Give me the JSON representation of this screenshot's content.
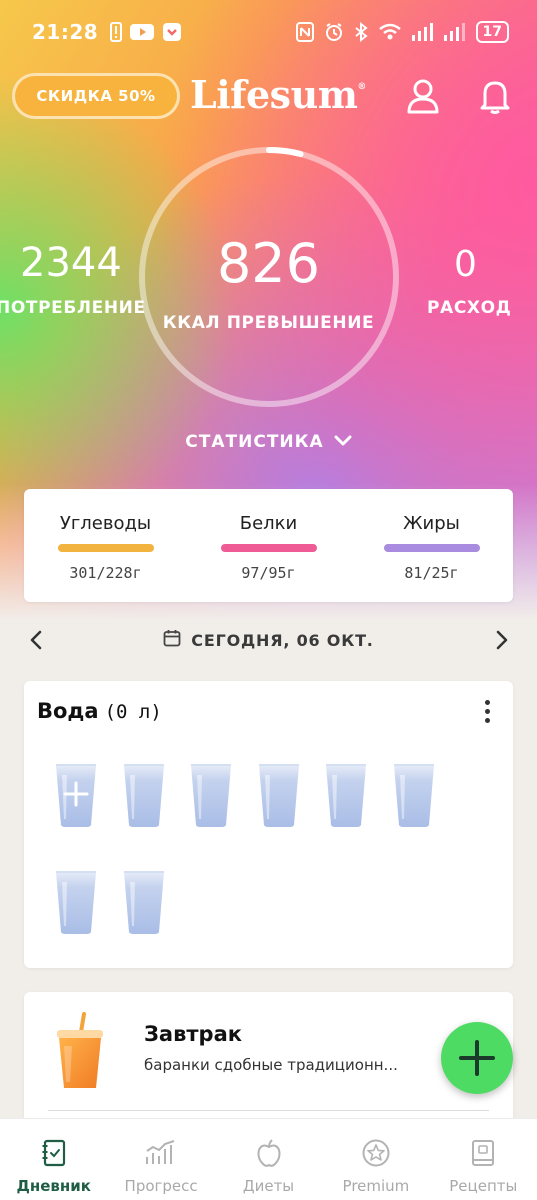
{
  "status_bar": {
    "time": "21:28",
    "battery": "17"
  },
  "header": {
    "discount_label": "СКИДКА 50%",
    "logo": "Lifesum",
    "logo_mark": "®"
  },
  "summary": {
    "intake_value": "2344",
    "intake_label": "ПОТРЕБЛЕНИЕ",
    "center_value": "826",
    "center_label": "ККАЛ ПРЕВЫШЕНИЕ",
    "burned_value": "0",
    "burned_label": "РАСХОД",
    "ring_progress": 0.04,
    "stats_label": "СТАТИСТИКА"
  },
  "macros": [
    {
      "name": "Углеводы",
      "value": "301/228г",
      "color": "#f2b33f"
    },
    {
      "name": "Белки",
      "value": "97/95г",
      "color": "#ef5b95"
    },
    {
      "name": "Жиры",
      "value": "81/25г",
      "color": "#a98be0"
    }
  ],
  "date": {
    "label": "СЕГОДНЯ, 06 ОКТ."
  },
  "water": {
    "title": "Вода",
    "amount": "(0 л)",
    "glass_count": 8
  },
  "meal": {
    "title": "Завтрак",
    "subtitle": "баранки сдобные традиционн..."
  },
  "nav": [
    {
      "label": "Дневник",
      "icon": "diary-icon",
      "active": true
    },
    {
      "label": "Прогресс",
      "icon": "progress-chart-icon",
      "active": false
    },
    {
      "label": "Диеты",
      "icon": "apple-icon",
      "active": false
    },
    {
      "label": "Premium",
      "icon": "star-icon",
      "active": false
    },
    {
      "label": "Рецепты",
      "icon": "recipe-book-icon",
      "active": false
    }
  ],
  "colors": {
    "accent_green": "#4ddb63",
    "nav_active": "#1f5e44",
    "discount_bg": "#f7b33d"
  }
}
